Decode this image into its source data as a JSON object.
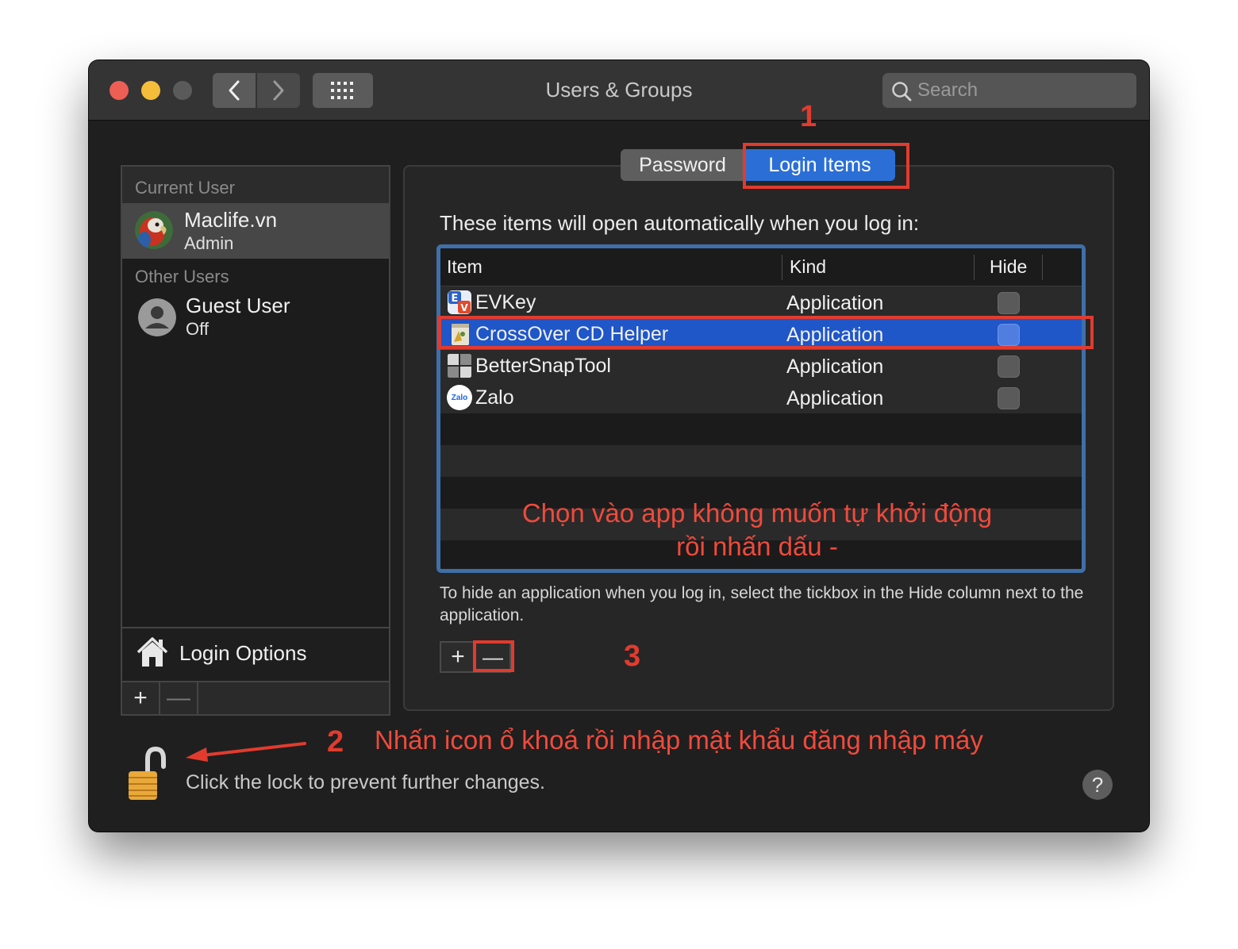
{
  "window": {
    "title": "Users & Groups",
    "search_placeholder": "Search"
  },
  "sidebar": {
    "current_user_header": "Current User",
    "current_user": {
      "name": "Maclife.vn",
      "role": "Admin"
    },
    "other_users_header": "Other Users",
    "other_users": [
      {
        "name": "Guest User",
        "status": "Off"
      }
    ],
    "login_options_label": "Login Options",
    "add_label": "+",
    "remove_label": "—"
  },
  "tabs": {
    "password": "Password",
    "login_items": "Login Items"
  },
  "main": {
    "description": "These items will open automatically when you log in:",
    "columns": {
      "item": "Item",
      "kind": "Kind",
      "hide": "Hide"
    },
    "rows": [
      {
        "name": "EVKey",
        "kind": "Application",
        "hide": false,
        "selected": false,
        "icon": "evkey-icon"
      },
      {
        "name": "CrossOver CD Helper",
        "kind": "Application",
        "hide": false,
        "selected": true,
        "icon": "crossover-icon"
      },
      {
        "name": "BetterSnapTool",
        "kind": "Application",
        "hide": false,
        "selected": false,
        "icon": "bettersnaptool-icon"
      },
      {
        "name": "Zalo",
        "kind": "Application",
        "hide": false,
        "selected": false,
        "icon": "zalo-icon",
        "icon_text": "Zalo"
      }
    ],
    "hint": "To hide an application when you log in, select the tickbox in the Hide column next to the application.",
    "add_label": "+",
    "remove_label": "—"
  },
  "footer": {
    "lock_text": "Click the lock to prevent further changes.",
    "help_label": "?"
  },
  "annotations": {
    "step1": "1",
    "step2": "2",
    "step3": "3",
    "step2_text": "Nhấn icon ổ khoá rồi nhập mật khẩu đăng nhập máy",
    "table_line1": "Chọn vào app không muốn tự khởi động",
    "table_line2": "rồi nhấn dấu -"
  },
  "colors": {
    "accent": "#2b6fd6",
    "selection": "#1f56c8",
    "annotation": "#e23b2e"
  }
}
